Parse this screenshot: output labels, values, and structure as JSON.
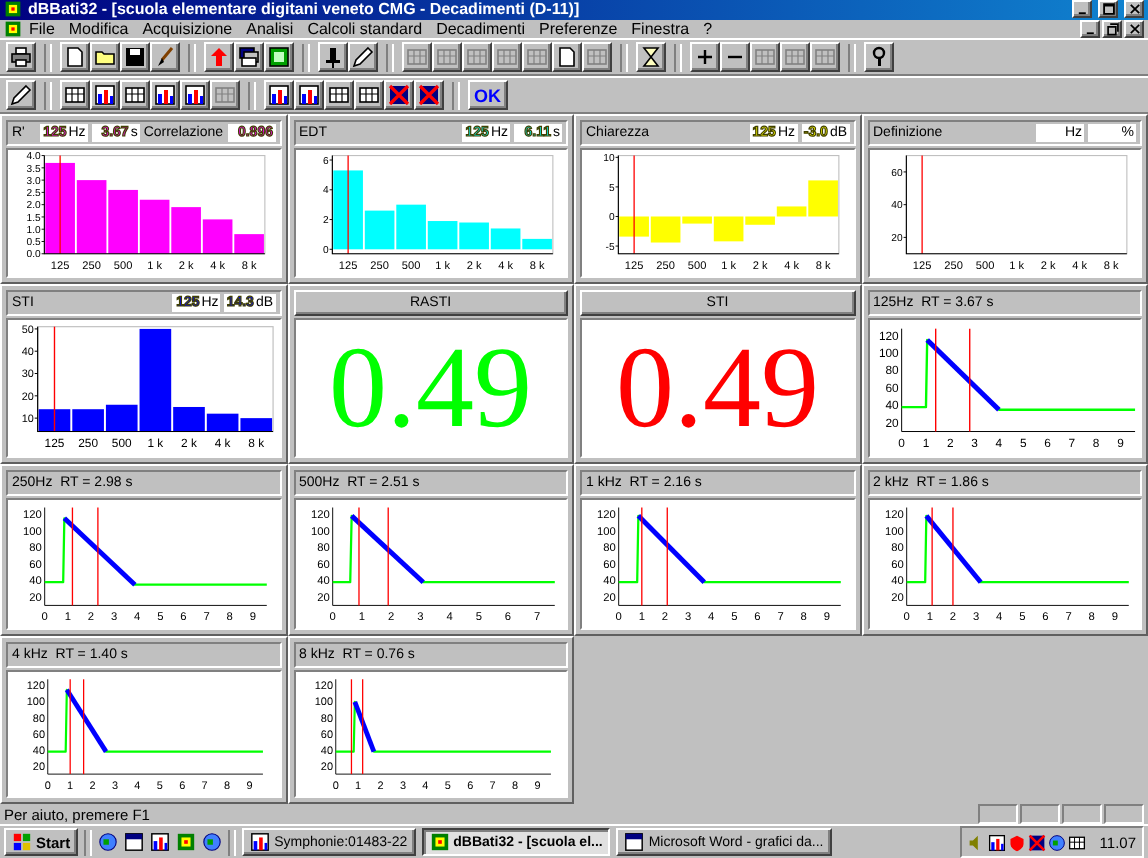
{
  "window": {
    "title": "dBBati32 - [scuola elementare digitani veneto CMG - Decadimenti (D-11)]"
  },
  "menu": [
    {
      "label": "File"
    },
    {
      "label": "Modifica"
    },
    {
      "label": "Acquisizione"
    },
    {
      "label": "Analisi"
    },
    {
      "label": "Calcoli standard"
    },
    {
      "label": "Decadimenti"
    },
    {
      "label": "Preferenze"
    },
    {
      "label": "Finestra"
    },
    {
      "label": "?"
    }
  ],
  "toolbar_2": {
    "ok_label": "OK"
  },
  "panels": [
    {
      "kind": "bar_chart",
      "readouts": [
        {
          "value": "125",
          "unit": "Hz"
        },
        {
          "value": "3.67",
          "unit": "s"
        }
      ],
      "correlation_label": "Correlazione",
      "correlation_value": "0.896",
      "chart_data": {
        "type": "bar",
        "title": "R'",
        "categories": [
          "125",
          "250",
          "500",
          "1 k",
          "2 k",
          "4 k",
          "8 k"
        ],
        "series": [
          {
            "color": "#ff00ff",
            "values": [
              3.7,
              3.0,
              2.6,
              2.2,
              1.9,
              1.4,
              0.8
            ]
          }
        ],
        "ylim": [
          0,
          4
        ],
        "yticks": [
          {
            "value": 0,
            "label": "0.0"
          },
          {
            "value": 0.5,
            "label": "0.5"
          },
          {
            "value": 1,
            "label": "1.0"
          },
          {
            "value": 1.5,
            "label": "1.5"
          },
          {
            "value": 2,
            "label": "2.0"
          },
          {
            "value": 2.5,
            "label": "2.5"
          },
          {
            "value": 3,
            "label": "3.0"
          },
          {
            "value": 3.5,
            "label": "3.5"
          },
          {
            "value": 4,
            "label": "4.0"
          }
        ],
        "ref_lines": [
          {
            "axis": "x",
            "value": "125",
            "color": "#ff0000"
          }
        ]
      }
    },
    {
      "kind": "bar_chart",
      "readouts": [
        {
          "value": "125",
          "unit": "Hz"
        },
        {
          "value": "6.11",
          "unit": "s"
        }
      ],
      "chart_data": {
        "type": "bar",
        "title": "EDT",
        "categories": [
          "125",
          "250",
          "500",
          "1 k",
          "2 k",
          "4 k",
          "8 k"
        ],
        "series": [
          {
            "color": "#00ffff",
            "values": [
              5.3,
              2.6,
              3.0,
              1.9,
              1.8,
              1.4,
              0.7
            ]
          }
        ],
        "ylim": [
          -0.3,
          6.3
        ],
        "yticks": [
          0,
          2,
          4,
          6
        ],
        "ref_lines": [
          {
            "axis": "x",
            "value": "125",
            "color": "#ff0000"
          }
        ]
      }
    },
    {
      "kind": "bar_chart",
      "readouts": [
        {
          "value": "125",
          "unit": "Hz"
        },
        {
          "value": "-3.0",
          "unit": "dB"
        }
      ],
      "chart_data": {
        "type": "bar",
        "title": "Chiarezza",
        "categories": [
          "125",
          "250",
          "500",
          "1 k",
          "2 k",
          "4 k",
          "8 k"
        ],
        "series": [
          {
            "color": "#ffff00",
            "values": [
              -3.4,
              -4.4,
              -1.2,
              -4.2,
              -1.4,
              1.7,
              6.1
            ]
          }
        ],
        "ylim": [
          -6.3,
          10.3
        ],
        "yticks": [
          -5,
          0,
          5,
          10
        ],
        "ref_lines": [
          {
            "axis": "x",
            "value": "125",
            "color": "#ff0000"
          }
        ]
      }
    },
    {
      "kind": "bar_chart",
      "readouts": [
        {
          "unit": "Hz"
        },
        {
          "unit": "%"
        }
      ],
      "chart_data": {
        "type": "bar",
        "title": "Definizione",
        "categories": [
          "125",
          "250",
          "500",
          "1 k",
          "2 k",
          "4 k",
          "8 k"
        ],
        "series": [
          {
            "values": [
              null,
              null,
              null,
              null,
              null,
              null,
              null
            ]
          }
        ],
        "ylim": [
          10,
          70
        ],
        "yticks": [
          20,
          40,
          60
        ],
        "ref_lines": [
          {
            "axis": "x",
            "value": "125",
            "color": "#ff0000"
          }
        ]
      }
    },
    {
      "kind": "bar_chart",
      "readouts": [
        {
          "value": "125",
          "unit": "Hz"
        },
        {
          "value": "14.3",
          "unit": "dB"
        }
      ],
      "chart_data": {
        "type": "bar",
        "title": "STI",
        "categories": [
          "125",
          "250",
          "500",
          "1 k",
          "2 k",
          "4 k",
          "8 k"
        ],
        "series": [
          {
            "color": "#0000ff",
            "values": [
              14,
              14,
              16,
              50,
              15,
              12,
              10
            ]
          }
        ],
        "ylim": [
          4,
          51
        ],
        "yticks": [
          10,
          20,
          30,
          40,
          50
        ],
        "ref_lines": [
          {
            "axis": "x",
            "value": "125",
            "color": "#ff0000"
          }
        ]
      }
    },
    {
      "kind": "big_value",
      "title": "RASTI",
      "value": "0.49",
      "color": "#00ff00"
    },
    {
      "kind": "big_value",
      "title": "STI",
      "value": "0.49",
      "color": "#ff0000"
    },
    {
      "kind": "decay",
      "chart_data": {
        "type": "line",
        "title": "125Hz  RT = 3.67 s",
        "x": [
          0,
          1.0,
          1.05,
          4.0,
          9.6
        ],
        "series": [
          {
            "color": "#00ff00",
            "values": [
              38,
              38,
              115,
              35,
              35
            ]
          },
          {
            "color": "#0000ff",
            "values": [
              null,
              null,
              115,
              35,
              null
            ]
          }
        ],
        "xlim": [
          0,
          9.6
        ],
        "ylim": [
          10,
          128
        ],
        "xticks": [
          0,
          1,
          2,
          3,
          4,
          5,
          6,
          7,
          8,
          9
        ],
        "yticks": [
          20,
          40,
          60,
          80,
          100,
          120
        ],
        "ref_lines": [
          {
            "axis": "x",
            "value": 1.4,
            "color": "#ff0000"
          },
          {
            "axis": "x",
            "value": 2.8,
            "color": "#ff0000"
          }
        ]
      }
    },
    {
      "kind": "decay",
      "chart_data": {
        "type": "line",
        "title": "250Hz  RT = 2.98 s",
        "x": [
          0,
          0.8,
          0.85,
          3.9,
          9.6
        ],
        "series": [
          {
            "color": "#00ff00",
            "values": [
              38,
              38,
              115,
              35,
              35
            ]
          },
          {
            "color": "#0000ff",
            "values": [
              null,
              null,
              115,
              35,
              null
            ]
          }
        ],
        "xlim": [
          0,
          9.6
        ],
        "ylim": [
          10,
          128
        ],
        "xticks": [
          0,
          1,
          2,
          3,
          4,
          5,
          6,
          7,
          8,
          9
        ],
        "yticks": [
          20,
          40,
          60,
          80,
          100,
          120
        ],
        "ref_lines": [
          {
            "axis": "x",
            "value": 1.2,
            "color": "#ff0000"
          },
          {
            "axis": "x",
            "value": 2.3,
            "color": "#ff0000"
          }
        ]
      }
    },
    {
      "kind": "decay",
      "chart_data": {
        "type": "line",
        "title": "500Hz  RT = 2.51 s",
        "x": [
          0,
          0.6,
          0.65,
          3.1,
          7.6
        ],
        "series": [
          {
            "color": "#00ff00",
            "values": [
              38,
              38,
              118,
              38,
              38
            ]
          },
          {
            "color": "#0000ff",
            "values": [
              null,
              null,
              118,
              38,
              null
            ]
          }
        ],
        "xlim": [
          0,
          7.6
        ],
        "ylim": [
          10,
          128
        ],
        "xticks": [
          0,
          1,
          2,
          3,
          4,
          5,
          6,
          7
        ],
        "yticks": [
          20,
          40,
          60,
          80,
          100,
          120
        ],
        "ref_lines": [
          {
            "axis": "x",
            "value": 0.9,
            "color": "#ff0000"
          },
          {
            "axis": "x",
            "value": 1.9,
            "color": "#ff0000"
          }
        ]
      }
    },
    {
      "kind": "decay",
      "chart_data": {
        "type": "line",
        "title": "1 kHz  RT = 2.16 s",
        "x": [
          0,
          0.8,
          0.85,
          3.7,
          9.6
        ],
        "series": [
          {
            "color": "#00ff00",
            "values": [
              38,
              38,
              118,
              38,
              38
            ]
          },
          {
            "color": "#0000ff",
            "values": [
              null,
              null,
              118,
              38,
              null
            ]
          }
        ],
        "xlim": [
          0,
          9.6
        ],
        "ylim": [
          10,
          128
        ],
        "xticks": [
          0,
          1,
          2,
          3,
          4,
          5,
          6,
          7,
          8,
          9
        ],
        "yticks": [
          20,
          40,
          60,
          80,
          100,
          120
        ],
        "ref_lines": [
          {
            "axis": "x",
            "value": 1.0,
            "color": "#ff0000"
          },
          {
            "axis": "x",
            "value": 2.1,
            "color": "#ff0000"
          }
        ]
      }
    },
    {
      "kind": "decay",
      "chart_data": {
        "type": "line",
        "title": "2 kHz  RT = 1.86 s",
        "x": [
          0,
          0.8,
          0.85,
          3.2,
          9.6
        ],
        "series": [
          {
            "color": "#00ff00",
            "values": [
              38,
              38,
              118,
              38,
              38
            ]
          },
          {
            "color": "#0000ff",
            "values": [
              null,
              null,
              118,
              38,
              null
            ]
          }
        ],
        "xlim": [
          0,
          9.6
        ],
        "ylim": [
          10,
          128
        ],
        "xticks": [
          0,
          1,
          2,
          3,
          4,
          5,
          6,
          7,
          8,
          9
        ],
        "yticks": [
          20,
          40,
          60,
          80,
          100,
          120
        ],
        "ref_lines": [
          {
            "axis": "x",
            "value": 1.1,
            "color": "#ff0000"
          },
          {
            "axis": "x",
            "value": 2.0,
            "color": "#ff0000"
          }
        ]
      }
    },
    {
      "kind": "decay",
      "chart_data": {
        "type": "line",
        "title": "4 kHz  RT = 1.40 s",
        "x": [
          0,
          0.8,
          0.85,
          2.6,
          9.6
        ],
        "series": [
          {
            "color": "#00ff00",
            "values": [
              38,
              38,
              115,
              38,
              38
            ]
          },
          {
            "color": "#0000ff",
            "values": [
              null,
              null,
              115,
              38,
              null
            ]
          }
        ],
        "xlim": [
          0,
          9.6
        ],
        "ylim": [
          10,
          128
        ],
        "xticks": [
          0,
          1,
          2,
          3,
          4,
          5,
          6,
          7,
          8,
          9
        ],
        "yticks": [
          20,
          40,
          60,
          80,
          100,
          120
        ],
        "ref_lines": [
          {
            "axis": "x",
            "value": 1.0,
            "color": "#ff0000"
          },
          {
            "axis": "x",
            "value": 1.6,
            "color": "#ff0000"
          }
        ]
      }
    },
    {
      "kind": "decay",
      "chart_data": {
        "type": "line",
        "title": "8 kHz  RT = 0.76 s",
        "x": [
          0,
          0.8,
          0.85,
          1.7,
          9.6
        ],
        "series": [
          {
            "color": "#00ff00",
            "values": [
              38,
              38,
              100,
              38,
              38
            ]
          },
          {
            "color": "#0000ff",
            "values": [
              null,
              null,
              100,
              38,
              null
            ]
          }
        ],
        "xlim": [
          0,
          9.6
        ],
        "ylim": [
          10,
          128
        ],
        "xticks": [
          0,
          1,
          2,
          3,
          4,
          5,
          6,
          7,
          8,
          9
        ],
        "yticks": [
          20,
          40,
          60,
          80,
          100,
          120
        ],
        "ref_lines": [
          {
            "axis": "x",
            "value": 0.7,
            "color": "#ff0000"
          },
          {
            "axis": "x",
            "value": 1.2,
            "color": "#ff0000"
          }
        ]
      }
    }
  ],
  "status_bar": {
    "text": "Per aiuto, premere F1"
  },
  "taskbar": {
    "start_label": "Start",
    "tasks": [
      {
        "label": "Symphonie:01483-22",
        "selected": false
      },
      {
        "label": "dBBati32 - [scuola el...",
        "selected": true
      },
      {
        "label": "Microsoft Word - grafici da...",
        "selected": false
      }
    ],
    "clock": "11.07"
  }
}
